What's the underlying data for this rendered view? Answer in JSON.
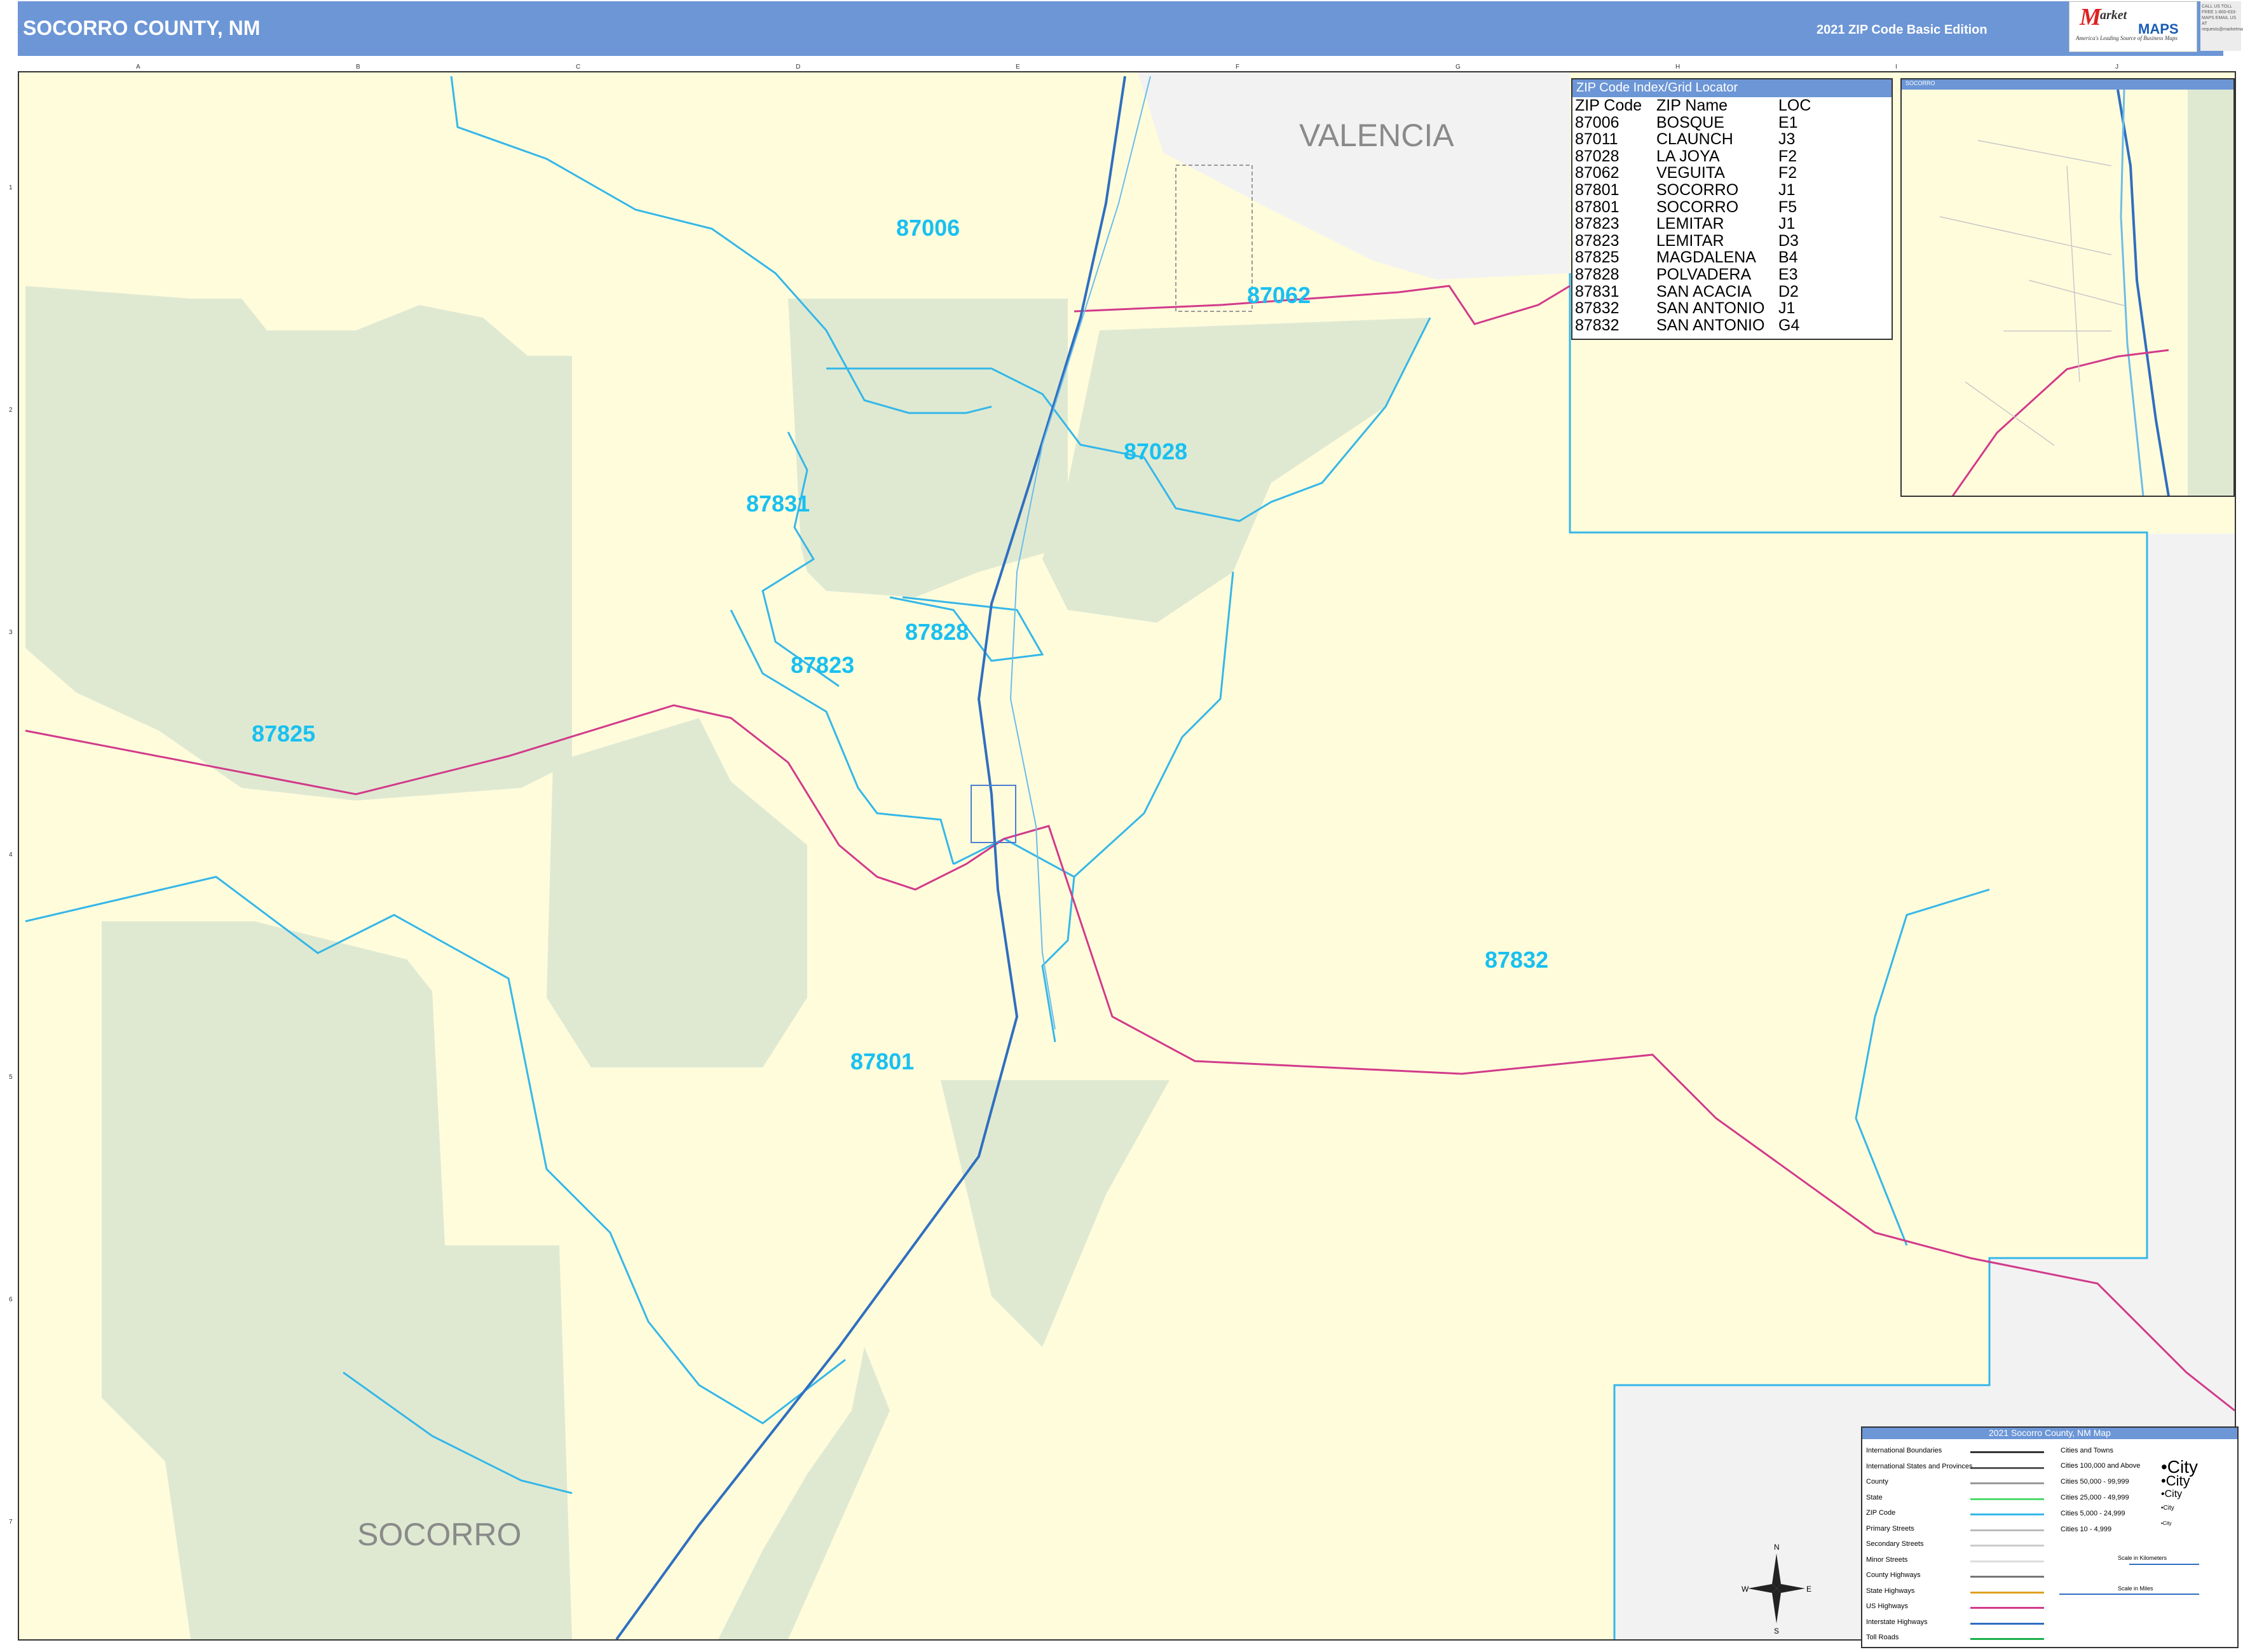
{
  "header": {
    "title": "SOCORRO COUNTY, NM",
    "edition": "2021 ZIP Code Basic Edition",
    "logo_mark": "M",
    "logo_top": "arket",
    "logo_bottom": "MAPS",
    "logo_tagline": "America's Leading Source of Business Maps",
    "call_text": "CALL US TOLL FREE 1-800-633-MAPS EMAIL US AT requests@marketmaps.com"
  },
  "grid": {
    "columns": [
      "A",
      "B",
      "C",
      "D",
      "E",
      "F",
      "G",
      "H",
      "I",
      "J"
    ],
    "rows": [
      "1",
      "2",
      "3",
      "4",
      "5",
      "6",
      "7"
    ]
  },
  "zip_labels": [
    {
      "code": "87006"
    },
    {
      "code": "87062"
    },
    {
      "code": "87028"
    },
    {
      "code": "87831"
    },
    {
      "code": "87828"
    },
    {
      "code": "87823"
    },
    {
      "code": "87825"
    },
    {
      "code": "87832"
    },
    {
      "code": "87801"
    }
  ],
  "county_labels": {
    "valencia": "VALENCIA",
    "socorro": "SOCORRO"
  },
  "index": {
    "title": "ZIP Code Index/Grid Locator",
    "columns": [
      "ZIP Code",
      "ZIP Name",
      "LOC"
    ],
    "rows": [
      [
        "87006",
        "BOSQUE",
        "E1"
      ],
      [
        "87011",
        "CLAUNCH",
        "J3"
      ],
      [
        "87028",
        "LA JOYA",
        "F2"
      ],
      [
        "87062",
        "VEGUITA",
        "F2"
      ],
      [
        "87801",
        "SOCORRO",
        "J1"
      ],
      [
        "87801",
        "SOCORRO",
        "F5"
      ],
      [
        "87823",
        "LEMITAR",
        "J1"
      ],
      [
        "87823",
        "LEMITAR",
        "D3"
      ],
      [
        "87825",
        "MAGDALENA",
        "B4"
      ],
      [
        "87828",
        "POLVADERA",
        "E3"
      ],
      [
        "87831",
        "SAN ACACIA",
        "D2"
      ],
      [
        "87832",
        "SAN ANTONIO",
        "J1"
      ],
      [
        "87832",
        "SAN ANTONIO",
        "G4"
      ]
    ]
  },
  "inset": {
    "title": "SOCORRO"
  },
  "legend": {
    "title": "2021 Socorro County, NM Map",
    "line_items": [
      "International Boundaries",
      "International States and Provinces",
      "County",
      "State",
      "ZIP Code",
      "Primary Streets",
      "Secondary Streets",
      "Minor Streets",
      "County Highways",
      "State Highways",
      "US Highways",
      "Interstate Highways",
      "Toll Roads"
    ],
    "cities_header": "Cities and Towns",
    "city_sizes": [
      "Cities 100,000 and Above",
      "Cities 50,000 - 99,999",
      "Cities 25,000 - 49,999",
      "Cities 5,000 - 24,999",
      "Cities 10 - 4,999"
    ],
    "city_samples": [
      "•City",
      "•City",
      "•City",
      "•City",
      "•City"
    ],
    "scale_km": "Scale in Kilometers",
    "scale_mi": "Scale in Miles",
    "compass": {
      "n": "N",
      "s": "S",
      "e": "E",
      "w": "W"
    }
  },
  "colors": {
    "header": "#6c96d6",
    "land": "#fffcdc",
    "forest": "#dfe9d2",
    "outside": "#f2f2f2",
    "zip_boundary": "#35b7e8",
    "zip_label": "#19c0f0",
    "interstate": "#2f6fbf",
    "us_highway": "#d23a8a"
  }
}
